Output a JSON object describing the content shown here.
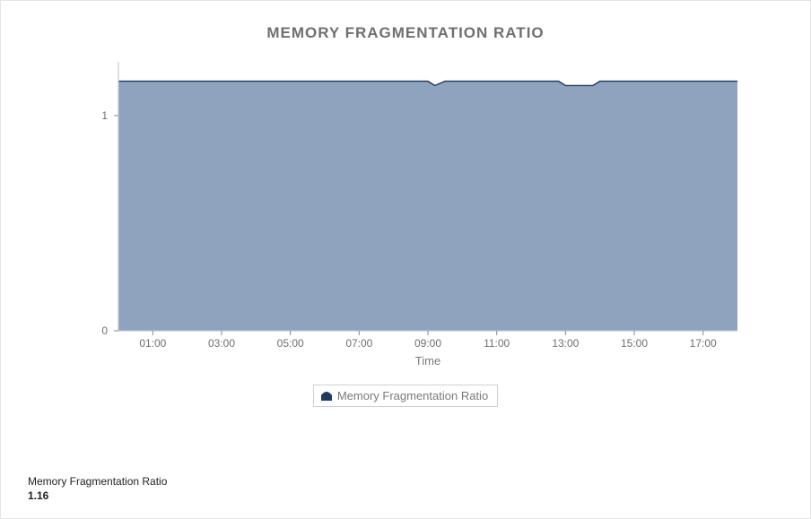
{
  "chart_data": {
    "type": "area",
    "title": "MEMORY FRAGMENTATION RATIO",
    "xlabel": "Time",
    "ylabel": "",
    "ylim": [
      0,
      1.25
    ],
    "xlim_hours": [
      0,
      18
    ],
    "x_ticks": [
      "01:00",
      "03:00",
      "05:00",
      "07:00",
      "09:00",
      "11:00",
      "13:00",
      "15:00",
      "17:00"
    ],
    "y_ticks": [
      0,
      1
    ],
    "series": [
      {
        "name": "Memory Fragmentation Ratio",
        "color": "#8fa3bf",
        "stroke": "#1f3a63",
        "x_hours": [
          0,
          1,
          2,
          3,
          4,
          5,
          6,
          7,
          8,
          9,
          9.2,
          9.5,
          10,
          11,
          12,
          12.8,
          13,
          13.8,
          14,
          15,
          16,
          17,
          18
        ],
        "values": [
          1.16,
          1.16,
          1.16,
          1.16,
          1.16,
          1.16,
          1.16,
          1.16,
          1.16,
          1.16,
          1.14,
          1.16,
          1.16,
          1.16,
          1.16,
          1.16,
          1.14,
          1.14,
          1.16,
          1.16,
          1.16,
          1.16,
          1.16
        ]
      }
    ],
    "legend": [
      "Memory Fragmentation Ratio"
    ]
  },
  "footer": {
    "label": "Memory Fragmentation Ratio",
    "value": "1.16"
  }
}
